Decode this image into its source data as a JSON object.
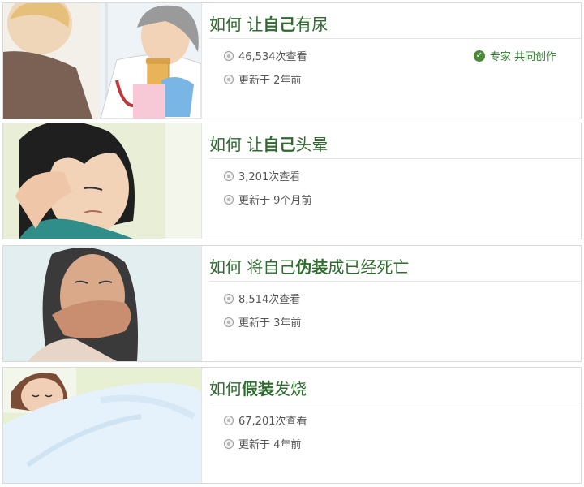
{
  "articles": [
    {
      "title_prefix": "如何 让",
      "title_bold": "自己",
      "title_suffix": "有尿",
      "views": "46,534次查看",
      "updated": "更新于 2年前",
      "badge": "专家 共同创作",
      "thumb_icon": "doctor-with-urine-cup-illustration"
    },
    {
      "title_prefix": "如何 让",
      "title_bold": "自己",
      "title_suffix": "头晕",
      "views": "3,201次查看",
      "updated": "更新于 9个月前",
      "thumb_icon": "dizzy-woman-illustration"
    },
    {
      "title_prefix": "如何 将自己",
      "title_bold": "伪装",
      "title_suffix": "成已经死亡",
      "views": "8,514次查看",
      "updated": "更新于 3年前",
      "thumb_icon": "woman-covering-mouth-illustration"
    },
    {
      "title_prefix": "如何",
      "title_bold": "假装",
      "title_suffix": "发烧",
      "views": "67,201次查看",
      "updated": "更新于 4年前",
      "thumb_icon": "sick-girl-in-bed-illustration"
    }
  ],
  "colors": {
    "title": "#2f6b2f",
    "badge": "#2f7a2f",
    "meta": "#555555"
  }
}
